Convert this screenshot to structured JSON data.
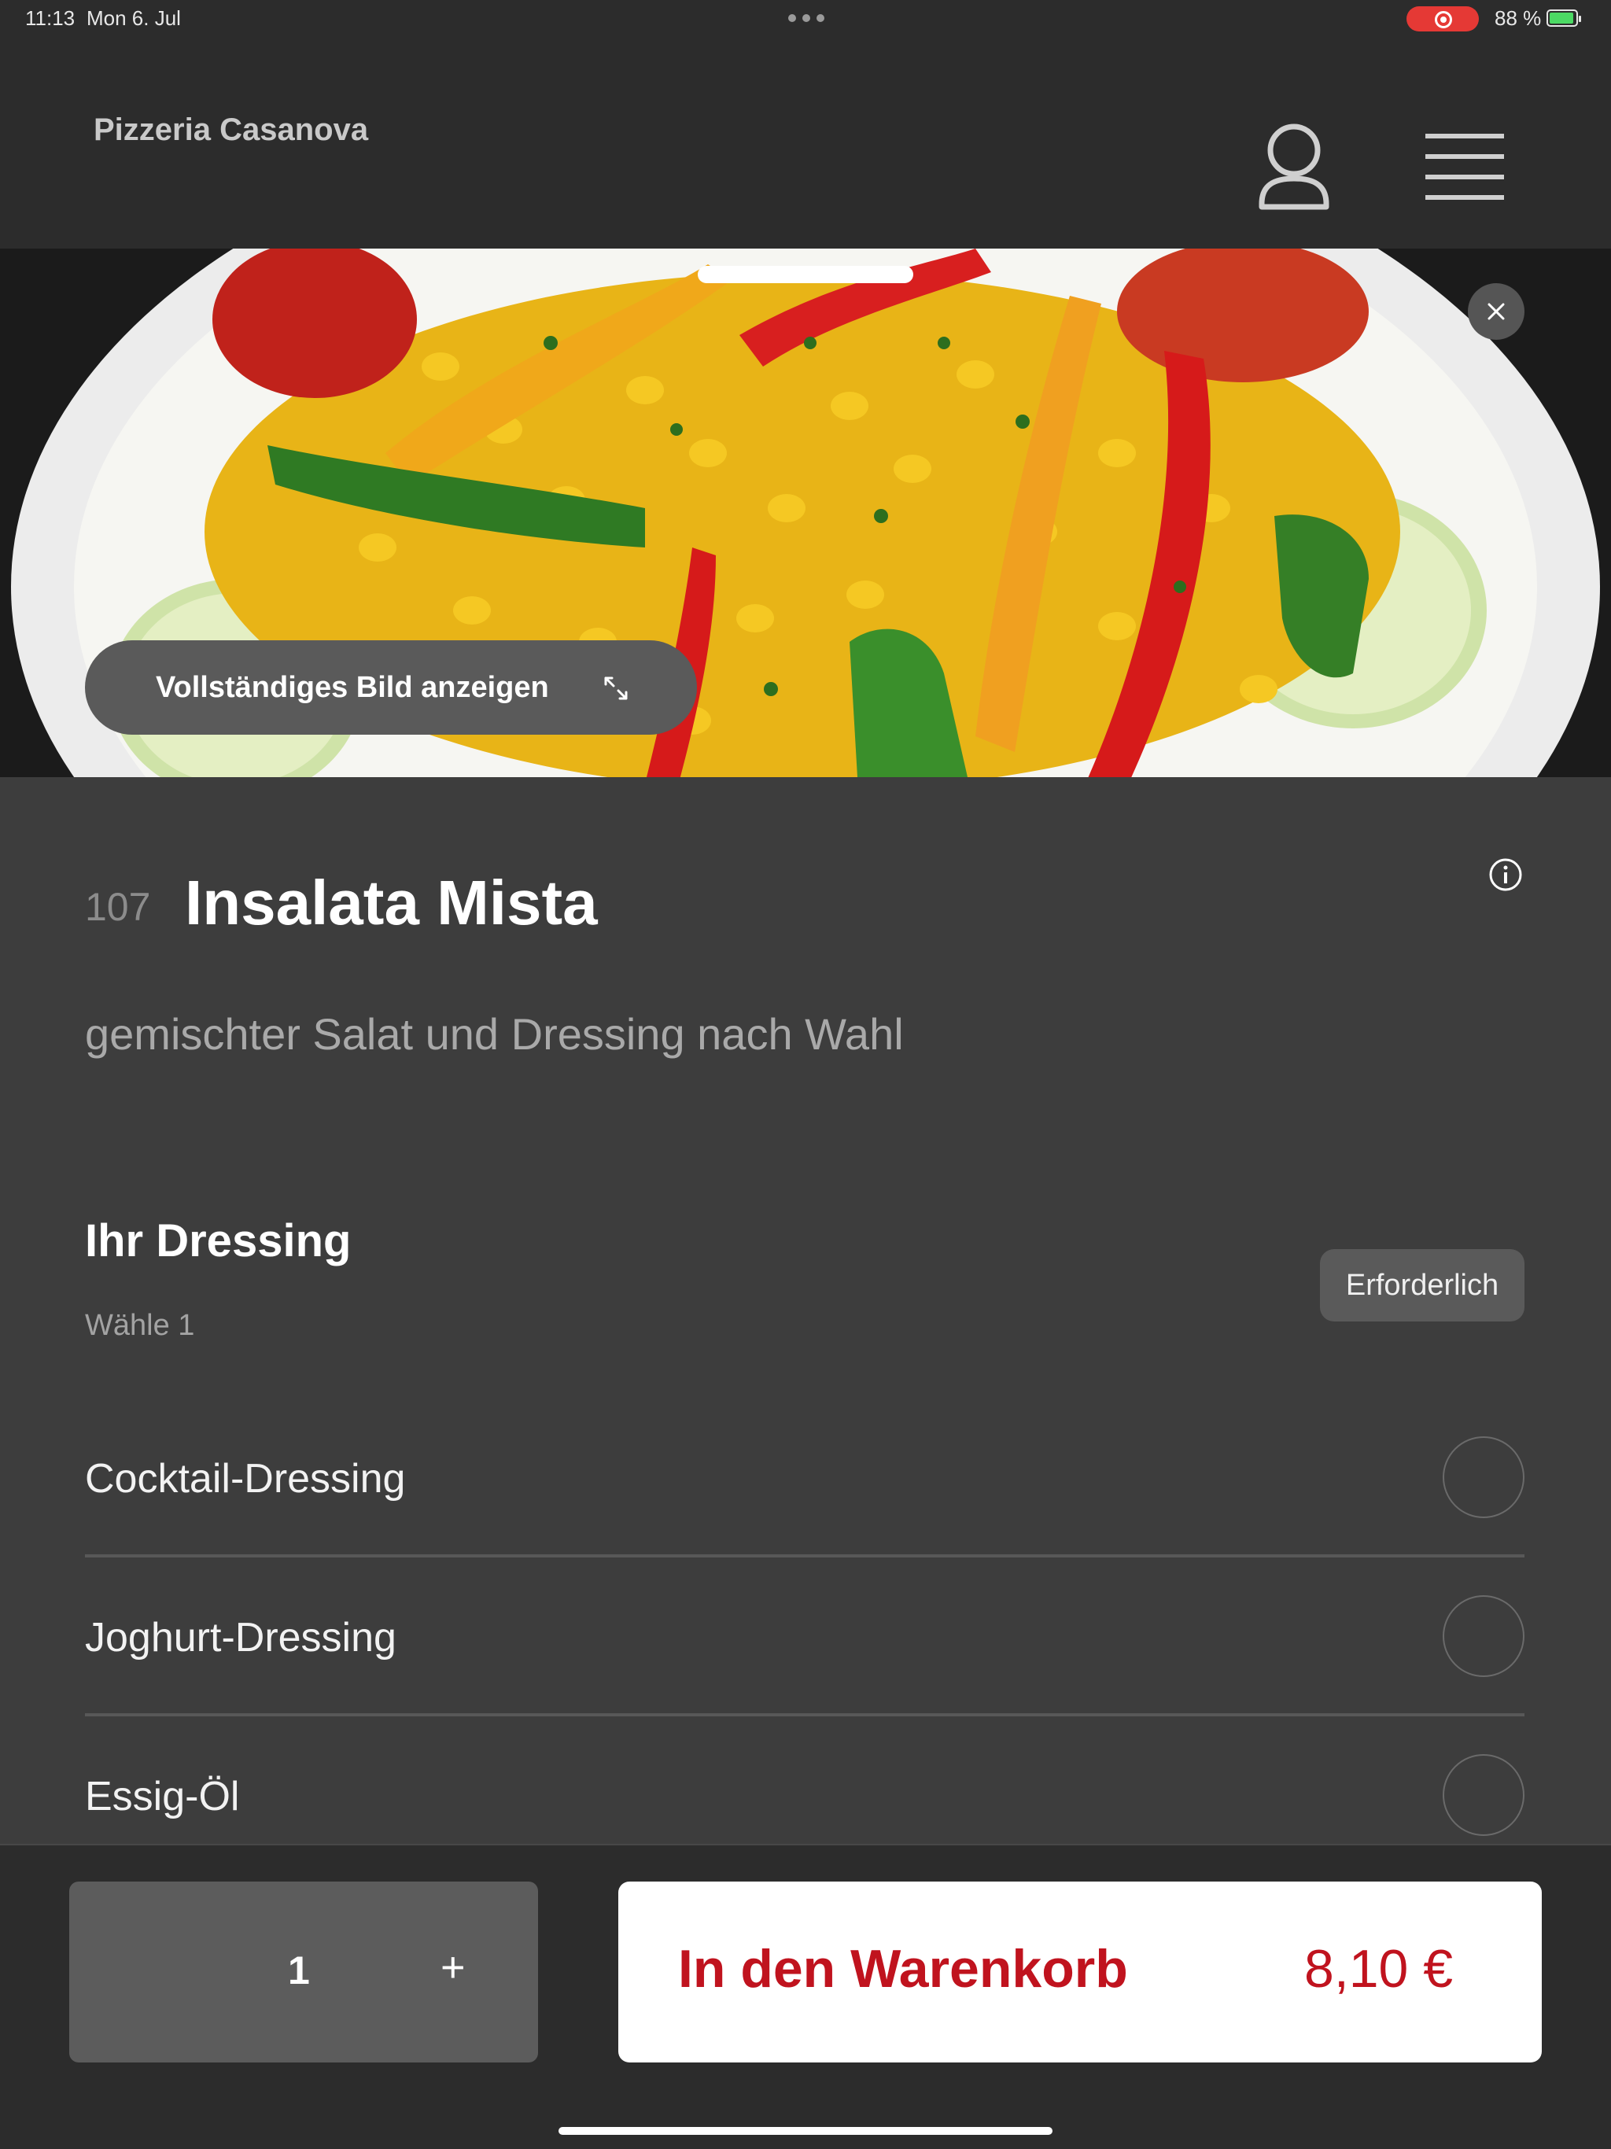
{
  "status_bar": {
    "time": "11:13",
    "date": "Mon 6. Jul",
    "battery": "88 %"
  },
  "header": {
    "restaurant_name": "Pizzeria Casanova",
    "icons": [
      "user-icon",
      "menu-icon"
    ]
  },
  "hero": {
    "show_full_image_label": "Vollständiges Bild anzeigen",
    "icons": [
      "close-icon",
      "expand-icon"
    ]
  },
  "item": {
    "number": "107",
    "title": "Insalata Mista",
    "description": "gemischter Salat und Dressing nach Wahl"
  },
  "option_group": {
    "title": "Ihr Dressing",
    "subtitle": "Wähle 1",
    "badge": "Erforderlich",
    "options": [
      {
        "label": "Cocktail-Dressing",
        "selected": false
      },
      {
        "label": "Joghurt-Dressing",
        "selected": false
      },
      {
        "label": "Essig-Öl",
        "selected": false
      }
    ]
  },
  "footer": {
    "quantity": "1",
    "increment_label": "+",
    "add_to_cart_label": "In den Warenkorb",
    "price": "8,10 €"
  },
  "colors": {
    "background": "#2c2c2c",
    "content_background": "#3d3d3d",
    "accent_red": "#c0131e",
    "recording_red": "#e53935",
    "battery_green": "#4cd964"
  }
}
